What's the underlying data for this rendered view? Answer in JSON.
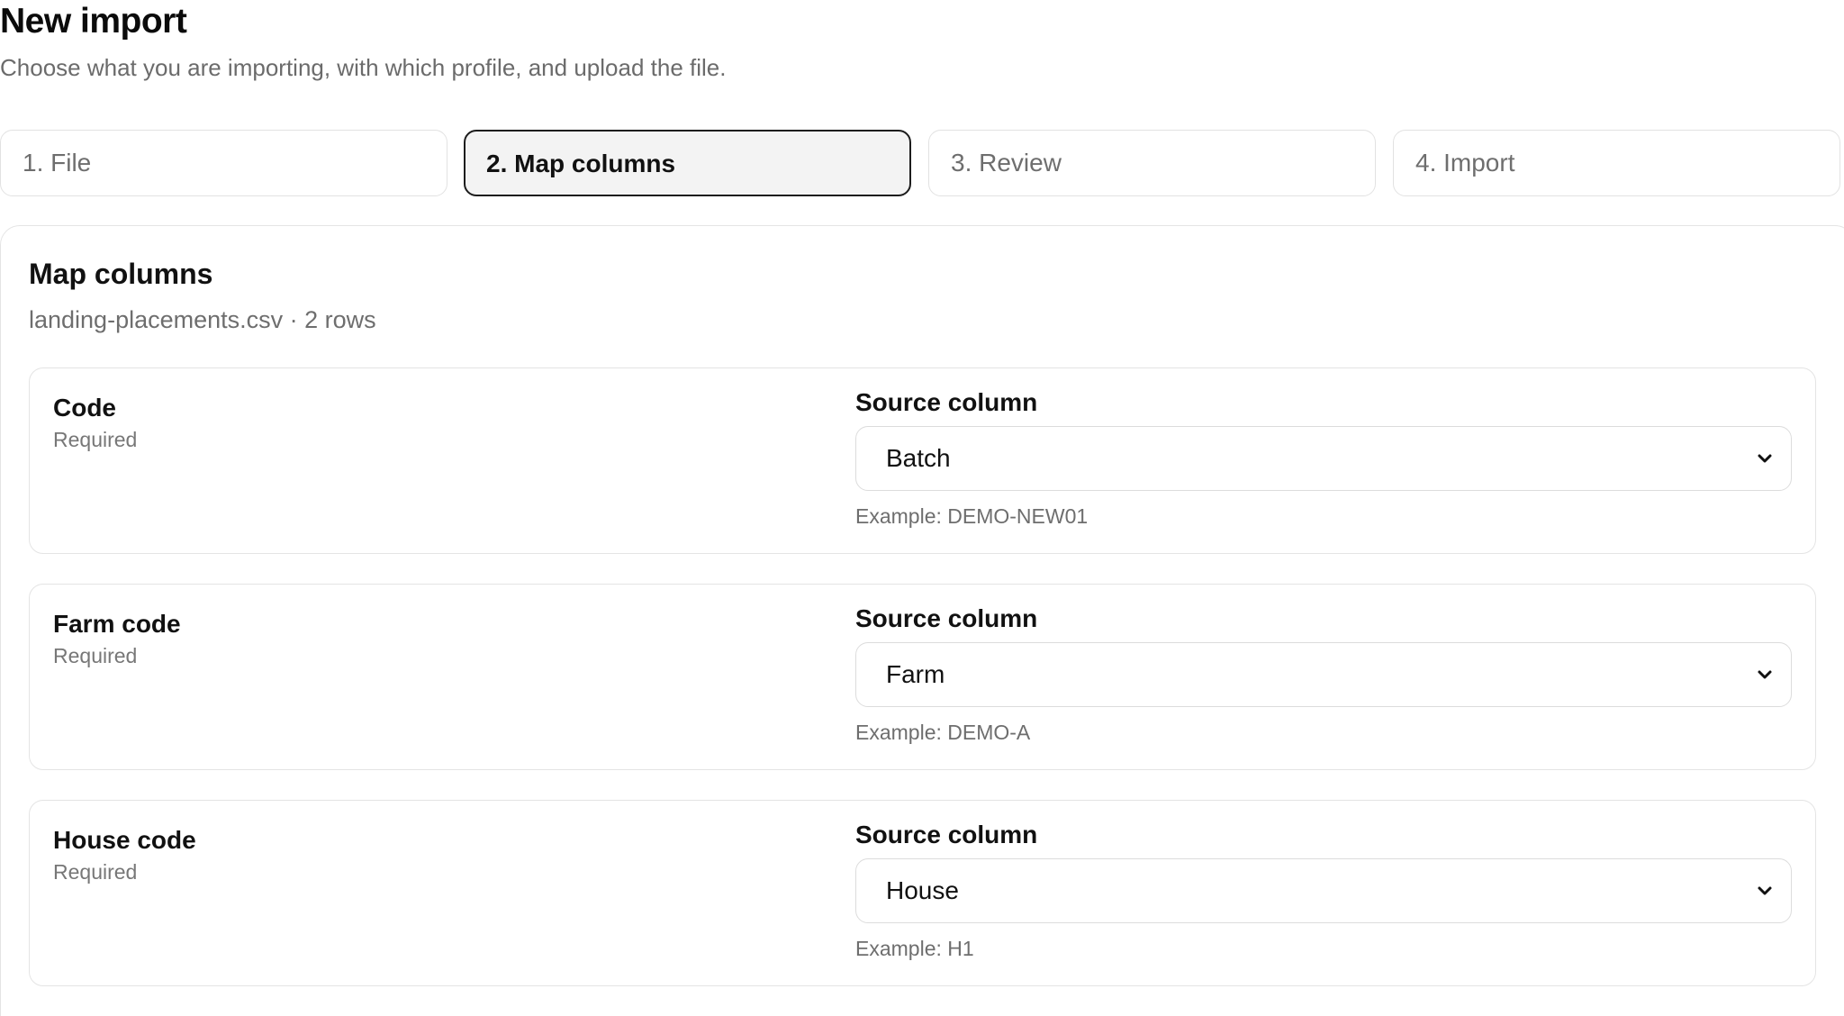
{
  "page": {
    "title": "New import",
    "subtitle": "Choose what you are importing, with which profile, and upload the file."
  },
  "steps": [
    {
      "label": "1. File",
      "active": false
    },
    {
      "label": "2. Map columns",
      "active": true
    },
    {
      "label": "3. Review",
      "active": false
    },
    {
      "label": "4. Import",
      "active": false
    }
  ],
  "mapping": {
    "title": "Map columns",
    "subtitle": "landing-placements.csv · 2 rows",
    "fields": [
      {
        "name": "Code",
        "requirement": "Required",
        "source_label": "Source column",
        "selected": "Batch",
        "example": "Example: DEMO-NEW01"
      },
      {
        "name": "Farm code",
        "requirement": "Required",
        "source_label": "Source column",
        "selected": "Farm",
        "example": "Example: DEMO-A"
      },
      {
        "name": "House code",
        "requirement": "Required",
        "source_label": "Source column",
        "selected": "House",
        "example": "Example: H1"
      }
    ]
  },
  "icons": {
    "select_chevron": "chevron-down-icon"
  }
}
